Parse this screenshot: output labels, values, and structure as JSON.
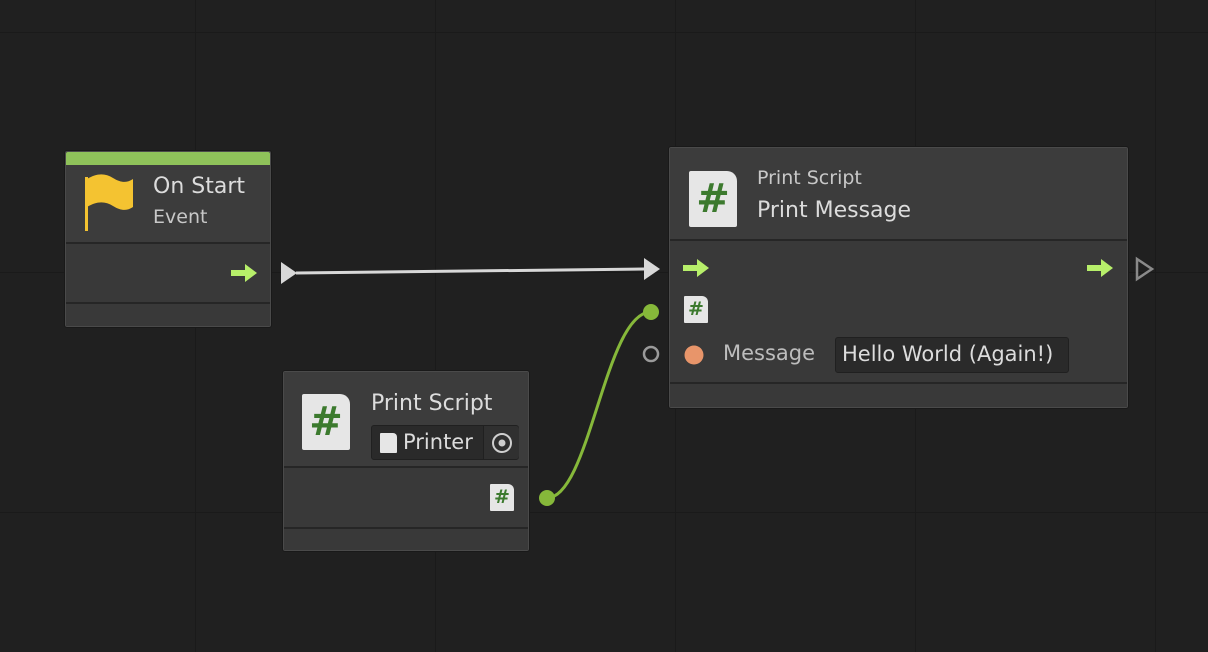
{
  "nodes": {
    "on_start": {
      "title": "On Start",
      "subtitle": "Event",
      "icon": "flag-icon",
      "accent_color": "#8fc25a"
    },
    "printer": {
      "category": "Print Script",
      "object_field_value": "Printer",
      "icon": "script-hash-icon"
    },
    "print_message": {
      "category": "Print Script",
      "title": "Print Message",
      "icon": "script-hash-icon",
      "input_label": "Message",
      "input_value": "Hello World (Again!)"
    }
  },
  "colors": {
    "flow_arrow": "#b7ef6a",
    "object_wire": "#86b83a",
    "string_port": "#e8956a",
    "flag": "#f4c331"
  }
}
